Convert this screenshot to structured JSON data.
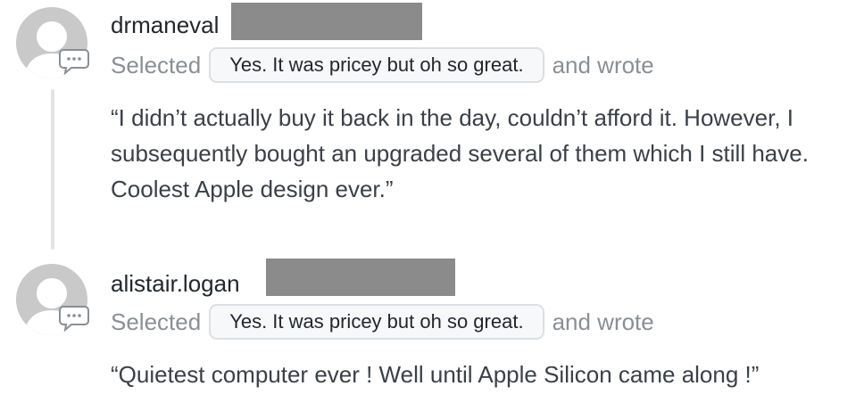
{
  "comments": [
    {
      "username": "drmaneval",
      "selected_label": "Selected",
      "selected_option": "Yes. It was pricey but oh so great.",
      "wrote_label": "and wrote",
      "quote": "“I didn’t actually buy it back in the day, couldn’t afford it. However, I subsequently bought an upgraded several of them which I still have. Coolest Apple design ever.”"
    },
    {
      "username": "alistair.logan",
      "selected_label": "Selected",
      "selected_option": "Yes. It was pricey but oh so great.",
      "wrote_label": "and wrote",
      "quote": "“Quietest computer ever ! Well until Apple Silicon came along !”"
    }
  ],
  "colors": {
    "avatar": "#c9c9c9",
    "redaction": "#8b8b8b",
    "muted_text": "#8a8f96",
    "thread_line": "#e3e3e3"
  },
  "icons": {
    "avatar": "default-user-avatar-icon",
    "reply": "chat-bubble-ellipsis-icon"
  }
}
